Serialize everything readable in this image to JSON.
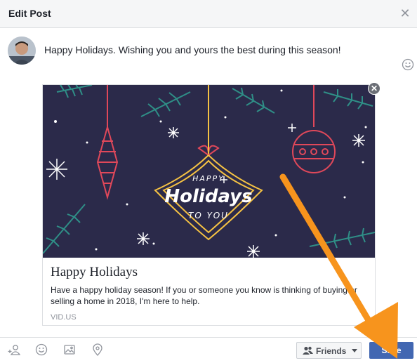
{
  "dialog": {
    "title": "Edit Post",
    "close_icon": "close-icon"
  },
  "post": {
    "text": "Happy Holidays. Wishing you and yours the best during this season!"
  },
  "card": {
    "image_text": {
      "line1": "HAPPY",
      "line2": "Holidays",
      "line3": "TO YOU"
    },
    "title": "Happy Holidays",
    "description": "Have a happy holiday season! If you or someone you know is thinking of buying or selling a home in 2018, I'm here to help.",
    "domain": "VID.US"
  },
  "footer": {
    "tools": [
      "tag-friends-icon",
      "feeling-icon",
      "photo-icon",
      "location-icon"
    ],
    "audience_label": "Friends",
    "save_label": "Save"
  },
  "colors": {
    "primary": "#4267b2",
    "card_bg": "#2b2a4a",
    "ornament_red": "#e0485a",
    "ornament_gold": "#f5c243",
    "pine_teal": "#2f8f87",
    "arrow_orange": "#f7941d"
  }
}
